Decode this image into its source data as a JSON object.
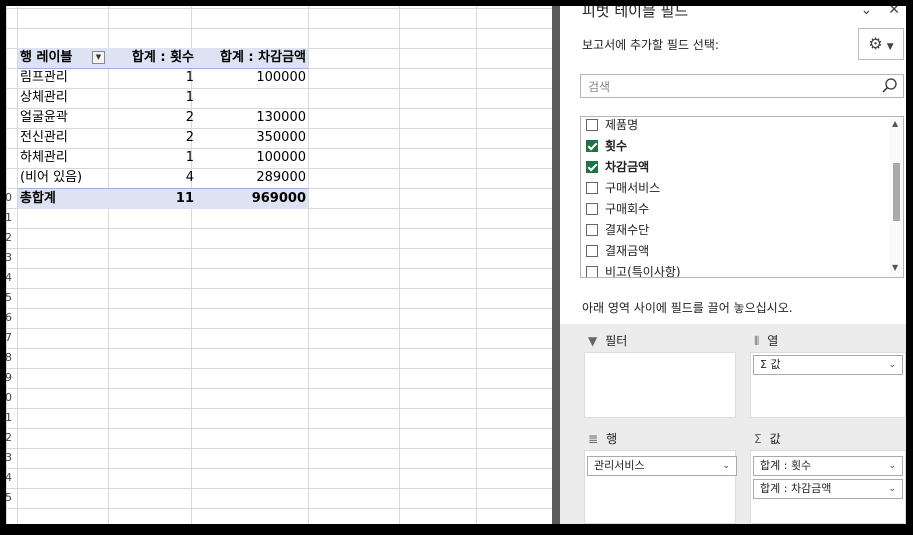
{
  "pivot_table": {
    "header": {
      "row_label": "행 레이블",
      "col_count": "합계 : 횟수",
      "col_amount": "합계 : 차감금액"
    },
    "rows": [
      {
        "label": "림프관리",
        "count": "1",
        "amount": "100000"
      },
      {
        "label": "상체관리",
        "count": "1",
        "amount": ""
      },
      {
        "label": "얼굴윤곽",
        "count": "2",
        "amount": "130000"
      },
      {
        "label": "전신관리",
        "count": "2",
        "amount": "350000"
      },
      {
        "label": "하체관리",
        "count": "1",
        "amount": "100000"
      },
      {
        "label": "(비어 있음)",
        "count": "4",
        "amount": "289000"
      }
    ],
    "total": {
      "label": "총합계",
      "count": "11",
      "amount": "969000"
    }
  },
  "row_numbers": [
    "0",
    "1",
    "2",
    "3",
    "4",
    "5",
    "6",
    "7",
    "8",
    "9",
    "0",
    "1",
    "2",
    "3",
    "4",
    "5"
  ],
  "field_pane": {
    "title": "피벗 테이블 필드",
    "add_label": "보고서에 추가할 필드 선택:",
    "search_placeholder": "검색",
    "fields": [
      {
        "label": "제품명",
        "checked": false
      },
      {
        "label": "횟수",
        "checked": true
      },
      {
        "label": "차감금액",
        "checked": true
      },
      {
        "label": "구매서비스",
        "checked": false
      },
      {
        "label": "구매회수",
        "checked": false
      },
      {
        "label": "결재수단",
        "checked": false
      },
      {
        "label": "결재금액",
        "checked": false
      },
      {
        "label": "비고(특이사항)",
        "checked": false
      }
    ],
    "drag_hint": "아래 영역 사이에 필드를 끌어 놓으십시오.",
    "areas": {
      "filter": {
        "label": "필터"
      },
      "columns": {
        "label": "열",
        "items": [
          "Σ 값"
        ]
      },
      "rows": {
        "label": "행",
        "items": [
          "관리서비스"
        ]
      },
      "values": {
        "label": "값",
        "items": [
          "합계 : 횟수",
          "합계 : 차감금액"
        ]
      }
    }
  },
  "colors": {
    "pivot_header_bg": "#dde3f2",
    "checkbox_on": "#217346",
    "divider": "#5a5a5a"
  },
  "icons": [
    "filter-dropdown-icon",
    "chevron-down-icon",
    "close-icon",
    "gear-icon",
    "search-icon",
    "filter-icon",
    "columns-icon",
    "rows-icon",
    "sigma-icon"
  ]
}
